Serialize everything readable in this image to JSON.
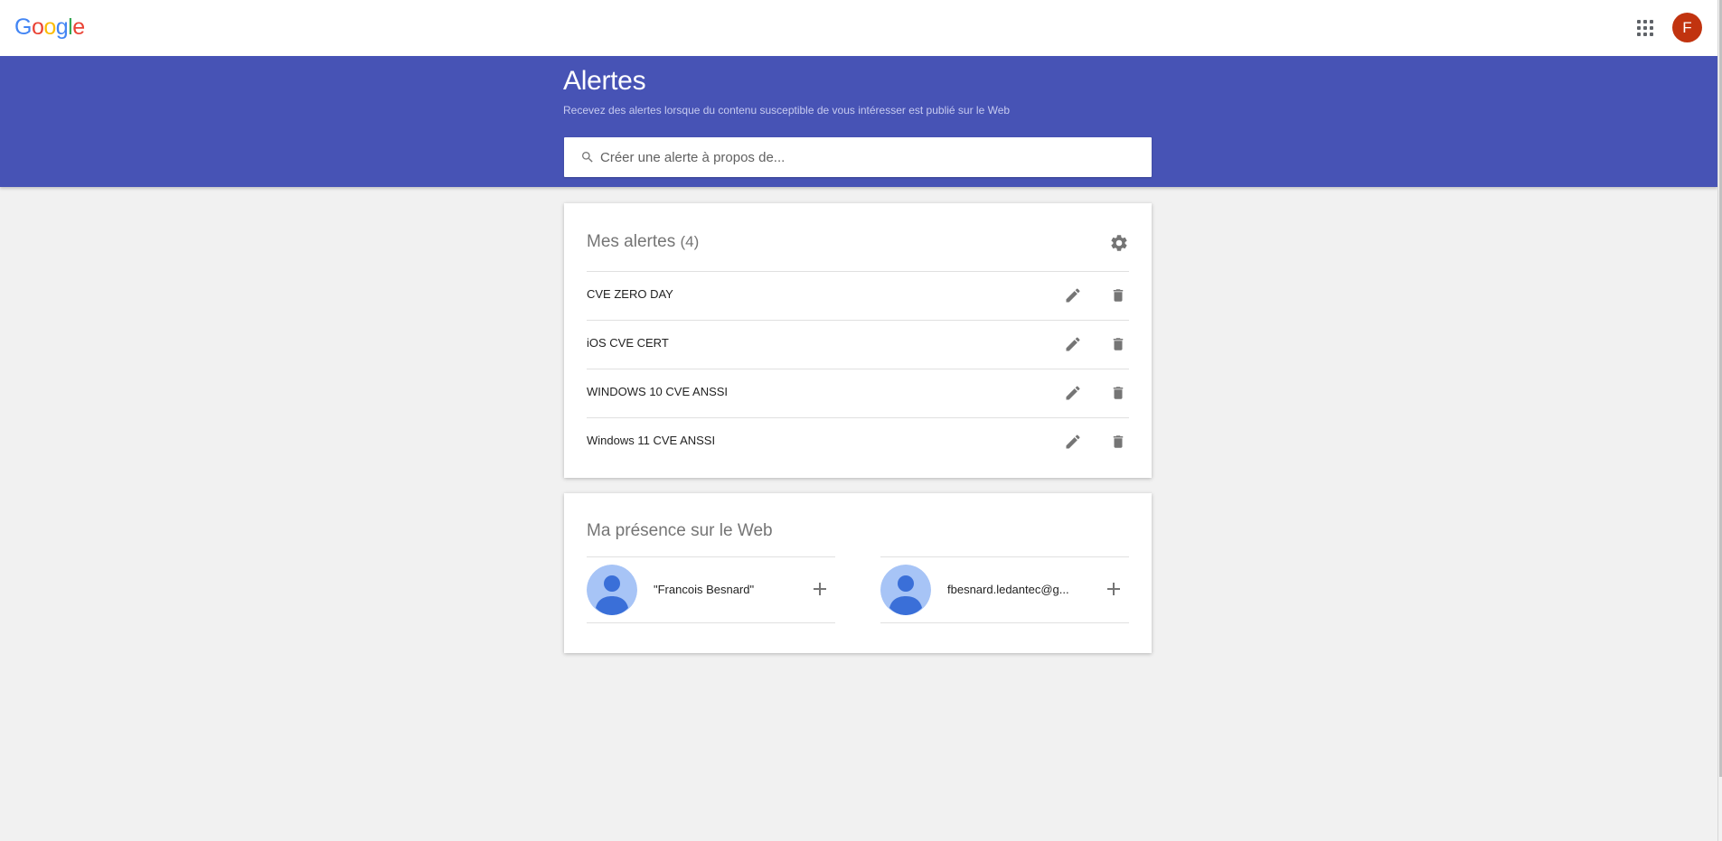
{
  "colors": {
    "brand_band": "#4753b5",
    "avatar_bg": "#c1330f",
    "icon_grey": "#757575",
    "person_avatar_bg": "#a7c4f6",
    "person_avatar_fg": "#3a6fd8"
  },
  "logo": {
    "letters": [
      {
        "char": "G",
        "color": "#4285f4"
      },
      {
        "char": "o",
        "color": "#ea4335"
      },
      {
        "char": "o",
        "color": "#fbbc05"
      },
      {
        "char": "g",
        "color": "#4285f4"
      },
      {
        "char": "l",
        "color": "#34a853"
      },
      {
        "char": "e",
        "color": "#ea4335"
      }
    ]
  },
  "header": {
    "apps_icon": "grid-apps-icon",
    "account_initial": "F"
  },
  "hero": {
    "title": "Alertes",
    "subtitle": "Recevez des alertes lorsque du contenu susceptible de vous intéresser est publié sur le Web",
    "search_placeholder": "Créer une alerte à propos de..."
  },
  "alerts_card": {
    "title": "Mes alertes",
    "count": "(4)",
    "settings_icon": "gear-icon",
    "items": [
      {
        "name": "CVE ZERO DAY"
      },
      {
        "name": "iOS CVE CERT"
      },
      {
        "name": "WINDOWS 10 CVE ANSSI"
      },
      {
        "name": "Windows 11 CVE ANSSI"
      }
    ]
  },
  "presence_card": {
    "title": "Ma présence sur le Web",
    "items": [
      {
        "label": "\"Francois Besnard\""
      },
      {
        "label": "fbesnard.ledantec@g..."
      }
    ]
  }
}
